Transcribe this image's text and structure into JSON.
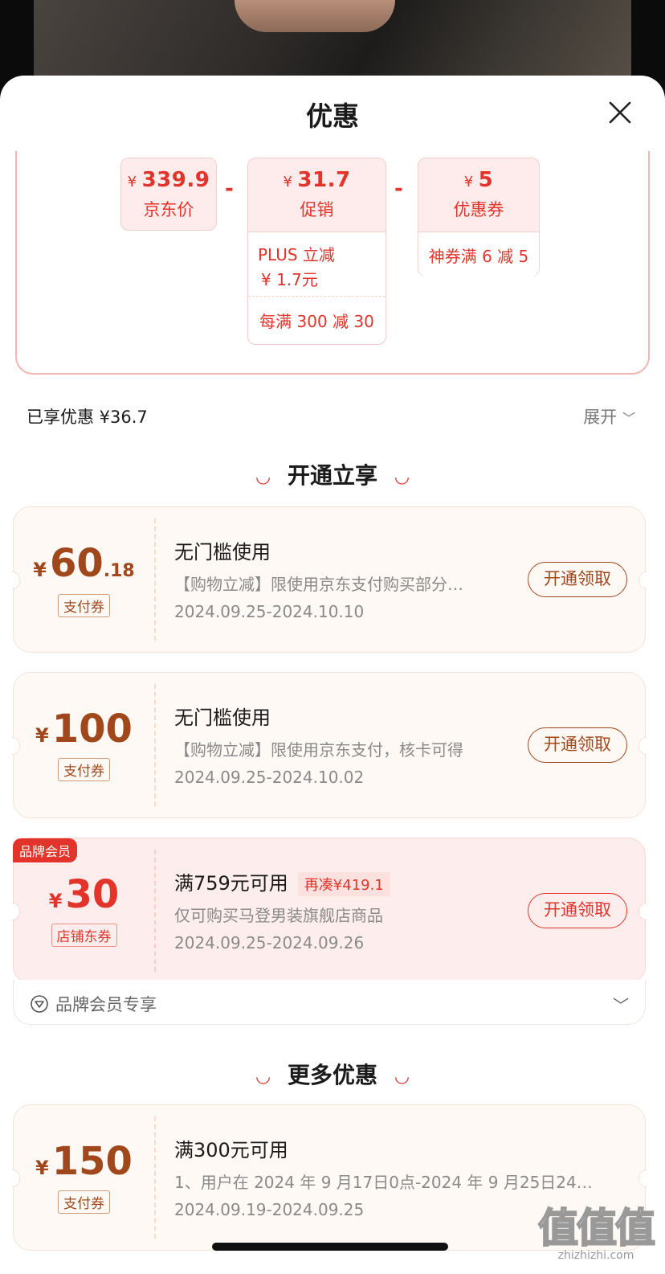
{
  "sheet": {
    "title": "优惠",
    "close_icon": "close-icon"
  },
  "price_calc": {
    "jd_price": {
      "amount": "339.9",
      "currency": "¥",
      "label": "京东价"
    },
    "promo": {
      "amount": "31.7",
      "currency": "¥",
      "label": "促销",
      "details": [
        "PLUS立减\n¥ 1.7元",
        "每满 300 减 30"
      ],
      "detail_1a": "PLUS 立减",
      "detail_1b": "¥ 1.7元",
      "detail_2": "每满 300 减 30"
    },
    "coupon": {
      "amount": "5",
      "currency": "¥",
      "label": "优惠券",
      "detail": "神券满 6 减 5"
    },
    "minus": "-"
  },
  "summary": {
    "enjoyed": "已享优惠 ¥36.7",
    "expand": "展开"
  },
  "section_open": {
    "title": "开通立享"
  },
  "coupons_open": [
    {
      "currency": "¥",
      "value": "60",
      "decimal": ".18",
      "tag": "支付券",
      "title": "无门槛使用",
      "desc": "【购物立减】限使用京东支付购买部分…",
      "dates": "2024.09.25-2024.10.10",
      "button": "开通领取"
    },
    {
      "currency": "¥",
      "value": "100",
      "decimal": "",
      "tag": "支付券",
      "title": "无门槛使用",
      "desc": "【购物立减】限使用京东支付，核卡可得",
      "dates": "2024.09.25-2024.10.02",
      "button": "开通领取"
    },
    {
      "badge": "品牌会员",
      "currency": "¥",
      "value": "30",
      "decimal": "",
      "tag": "店铺东券",
      "title": "满759元可用",
      "extra": "再凑¥419.1",
      "desc": "仅可购买马登男装旗舰店商品",
      "dates": "2024.09.25-2024.09.26",
      "button": "开通领取"
    }
  ],
  "brand_member": {
    "label": "品牌会员专享"
  },
  "section_more": {
    "title": "更多优惠"
  },
  "coupons_more": [
    {
      "currency": "¥",
      "value": "150",
      "decimal": "",
      "tag": "支付券",
      "title": "满300元可用",
      "desc": "1、用户在 2024 年 9 月17日0点-2024 年 9 月25日24…",
      "dates": "2024.09.19-2024.09.25"
    }
  ],
  "watermark": {
    "big": "值值值",
    "small": "zhizhizhi.com"
  }
}
